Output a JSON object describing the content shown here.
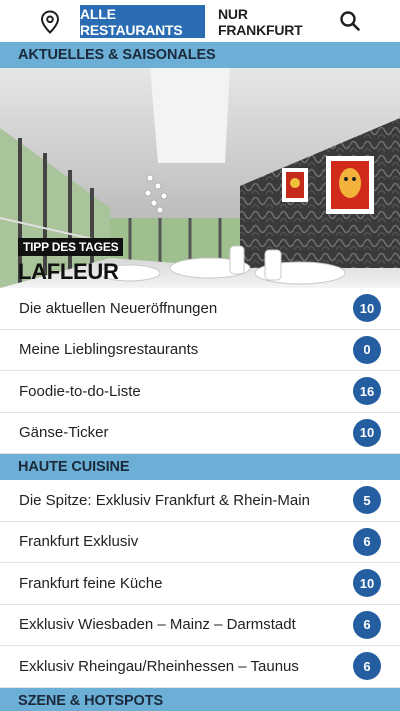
{
  "header": {
    "location_icon": "map-pin-icon",
    "tab_all": "ALLE RESTAURANTS",
    "tab_frankfurt": "NUR FRANKFURT",
    "search_icon": "search-icon",
    "accent_color": "#2a6db3"
  },
  "sections": {
    "aktuelles": {
      "title": "AKTUELLES & SAISONALES",
      "hero": {
        "tip_label": "TIPP DES TAGES",
        "title": "LAFLEUR"
      },
      "items": [
        {
          "label": "Die aktuellen Neueröffnungen",
          "count": "10"
        },
        {
          "label": "Meine Lieblingsrestaurants",
          "count": "0"
        },
        {
          "label": "Foodie-to-do-Liste",
          "count": "16"
        },
        {
          "label": "Gänse-Ticker",
          "count": "10"
        }
      ]
    },
    "haute_cuisine": {
      "title": "HAUTE CUISINE",
      "items": [
        {
          "label": "Die Spitze: Exklusiv Frankfurt & Rhein-Main",
          "count": "5"
        },
        {
          "label": "Frankfurt Exklusiv",
          "count": "6"
        },
        {
          "label": "Frankfurt feine Küche",
          "count": "10"
        },
        {
          "label": "Exklusiv Wiesbaden – Mainz – Darmstadt",
          "count": "6"
        },
        {
          "label": "Exklusiv Rheingau/Rheinhessen – Taunus",
          "count": "6"
        }
      ]
    },
    "szene": {
      "title": "SZENE & HOTSPOTS"
    }
  }
}
